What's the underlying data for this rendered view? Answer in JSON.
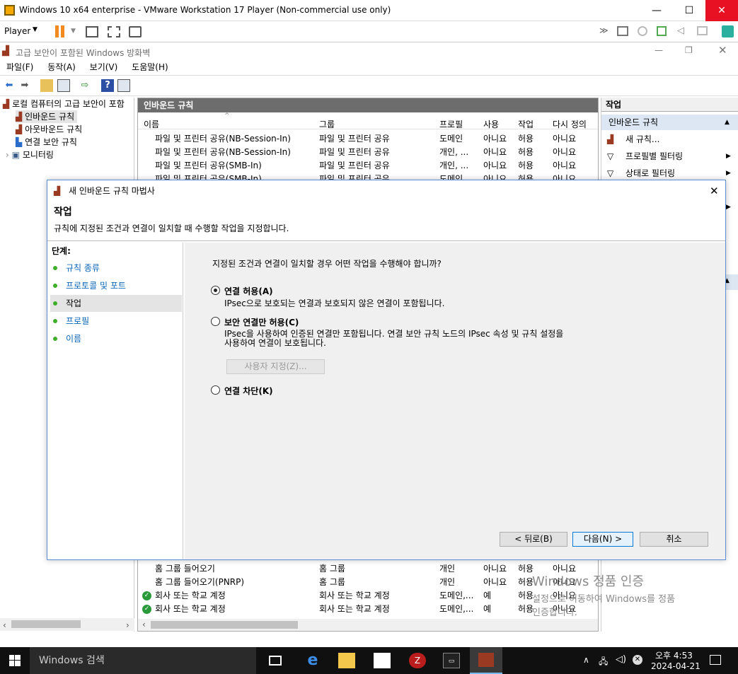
{
  "vm": {
    "title": "Windows 10 x64 enterprise - VMware Workstation 17 Player (Non-commercial use only)",
    "player_label": "Player",
    "minimize": "—",
    "maximize": "☐",
    "close": "✕"
  },
  "mmc": {
    "title": "고급 보안이 포함된 Windows 방화벽",
    "menu": [
      "파일(F)",
      "동작(A)",
      "보기(V)",
      "도움말(H)"
    ]
  },
  "tree": {
    "root": "로컬 컴퓨터의 고급 보안이 포함",
    "items": [
      "인바운드 규칙",
      "아웃바운드 규칙",
      "연결 보안 규칙",
      "모니터링"
    ]
  },
  "center": {
    "header": "인바운드 규칙",
    "columns": [
      "이름",
      "그룹",
      "프로필",
      "사용",
      "작업",
      "다시 정의"
    ],
    "top_rows": [
      [
        "파일 및 프린터 공유(NB-Session-In)",
        "파일 및 프린터 공유",
        "도메인",
        "아니요",
        "허용",
        "아니요"
      ],
      [
        "파일 및 프린터 공유(NB-Session-In)",
        "파일 및 프린터 공유",
        "개인, ...",
        "아니요",
        "허용",
        "아니요"
      ],
      [
        "파일 및 프린터 공유(SMB-In)",
        "파일 및 프린터 공유",
        "개인, ...",
        "아니요",
        "허용",
        "아니요"
      ],
      [
        "파일 및 프린터 공유(SMB-In)",
        "파일 및 프린터 공유",
        "도메인",
        "아니요",
        "허용",
        "아니요"
      ]
    ],
    "bottom_rows": [
      [
        "홈 그룹 들어오기",
        "홈 그룹",
        "개인",
        "아니요",
        "허용",
        "아니요"
      ],
      [
        "홈 그룹 들어오기(PNRP)",
        "홈 그룹",
        "개인",
        "아니요",
        "허용",
        "아니요"
      ],
      [
        "회사 또는 학교 계정",
        "회사 또는 학교 계정",
        "도메인,...",
        "예",
        "허용",
        "아니요"
      ],
      [
        "회사 또는 학교 계정",
        "회사 또는 학교 계정",
        "도메인,...",
        "예",
        "허용",
        "아니요"
      ]
    ]
  },
  "actions": {
    "header": "작업",
    "section": "인바운드 규칙",
    "items": [
      "새 규칙...",
      "프로필별 필터링",
      "상태로 필터링"
    ]
  },
  "dialog": {
    "title": "새 인바운드 규칙 마법사",
    "heading": "작업",
    "description": "규칙에 지정된 조건과 연결이 일치할 때 수행할 작업을 지정합니다.",
    "steps_label": "단계:",
    "steps": [
      "규칙 종류",
      "프로토콜 및 포트",
      "작업",
      "프로필",
      "이름"
    ],
    "question": "지정된 조건과 연결이 일치할 경우 어떤 작업을 수행해야 합니까?",
    "opt1": "연결 허용(A)",
    "opt1_desc": "IPsec으로 보호되는 연결과 보호되지 않은 연결이 포함됩니다.",
    "opt2": "보안 연결만 허용(C)",
    "opt2_desc1": "IPsec을 사용하여 인증된 연결만 포함됩니다. 연결 보안 규칙 노드의 IPsec 속성 및 규칙 설정을",
    "opt2_desc2": "사용하여 연결이 보호됩니다.",
    "customize": "사용자 지정(Z)...",
    "opt3": "연결 차단(K)",
    "back": "< 뒤로(B)",
    "next": "다음(N) >",
    "cancel": "취소"
  },
  "watermark": {
    "line1": "Windows 정품 인증",
    "line2": "설정으로 이동하여 Windows를 정품",
    "line3": "인증합니다."
  },
  "taskbar": {
    "search": "Windows 검색",
    "time": "오후 4:53",
    "date": "2024-04-21"
  }
}
